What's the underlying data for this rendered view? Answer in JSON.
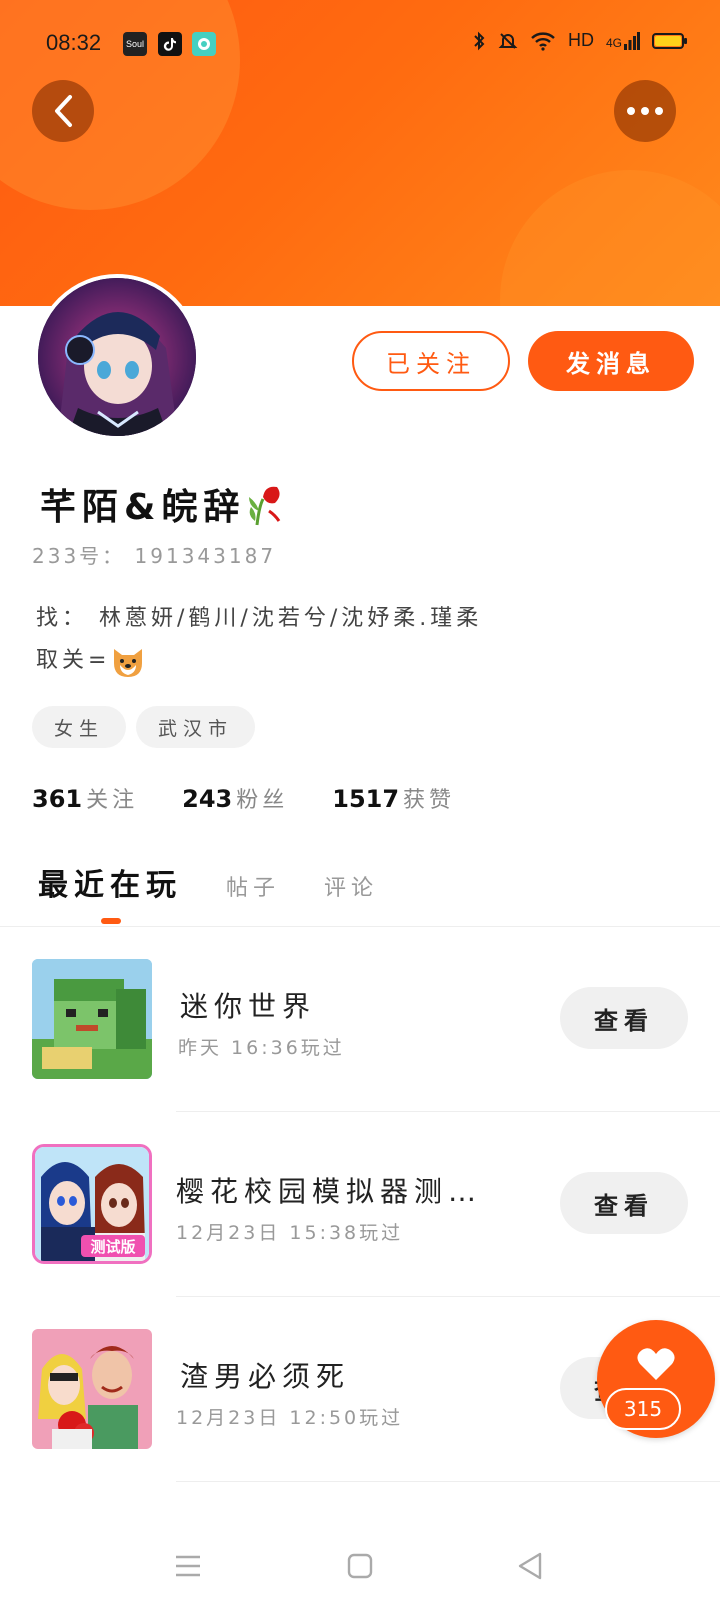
{
  "status_bar": {
    "time": "08:32",
    "apps": [
      "Soul",
      "TikTok",
      "Messenger"
    ],
    "network": "HD",
    "signal": "4G",
    "battery_color": "#ffd21a"
  },
  "colors": {
    "accent": "#ff5a12"
  },
  "header": {
    "back_icon": "chevron-left-icon",
    "more_icon": "more-dots-icon"
  },
  "profile": {
    "followed_label": "已关注",
    "message_label": "发消息",
    "username": "芊陌&皖辞",
    "user_id": "233号： 191343187",
    "bio_line1": "找： 林蒽妍/鹤川/沈若兮/沈妤柔.瑾柔",
    "bio_line2": "取关=",
    "tags": [
      "女生",
      "武汉市"
    ],
    "stats": [
      {
        "num": "361",
        "label": "关注"
      },
      {
        "num": "243",
        "label": "粉丝"
      },
      {
        "num": "1517",
        "label": "获赞"
      }
    ]
  },
  "tabs": [
    {
      "label": "最近在玩",
      "active": true
    },
    {
      "label": "帖子",
      "active": false
    },
    {
      "label": "评论",
      "active": false
    }
  ],
  "games": [
    {
      "name": "迷你世界",
      "time": "昨天 16:36玩过",
      "button": "查看"
    },
    {
      "name": "樱花校园模拟器测试版",
      "time": "12月23日 15:38玩过",
      "button": "查看"
    },
    {
      "name": "渣男必须死",
      "time": "12月23日 12:50玩过",
      "button": "查看"
    }
  ],
  "thumb_badge": "测试版",
  "like": {
    "count": "315"
  }
}
